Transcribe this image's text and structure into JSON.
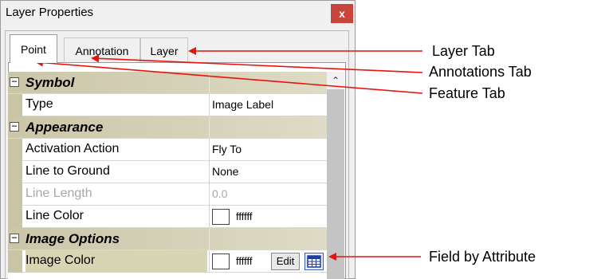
{
  "window": {
    "title": "Layer Properties",
    "close_glyph": "x"
  },
  "tabs": [
    {
      "label": "Point",
      "active": true
    },
    {
      "label": "Annotation",
      "active": false
    },
    {
      "label": "Layer",
      "active": false
    }
  ],
  "grid": {
    "expander_glyph": "−",
    "scroll_up_glyph": "⌃",
    "rows": [
      {
        "kind": "category",
        "label": "Symbol"
      },
      {
        "kind": "property",
        "name": "Type",
        "value": "Image Label"
      },
      {
        "kind": "category",
        "label": "Appearance"
      },
      {
        "kind": "property",
        "name": "Activation Action",
        "value": "Fly To"
      },
      {
        "kind": "property",
        "name": "Line to Ground",
        "value": "None"
      },
      {
        "kind": "property",
        "name": "Line Length",
        "value": "0.0",
        "disabled": true
      },
      {
        "kind": "property",
        "name": "Line Color",
        "value": "ffffff",
        "swatch": "#ffffff"
      },
      {
        "kind": "category",
        "label": "Image Options"
      },
      {
        "kind": "property",
        "name": "Image Color",
        "value": "ffffff",
        "swatch": "#ffffff",
        "edit_label": "Edit",
        "selected": true
      }
    ]
  },
  "annotations": {
    "layer_tab": "Layer Tab",
    "annotations_tab": "Annotations Tab",
    "feature_tab": "Feature Tab",
    "field_by_attribute": "Field by Attribute"
  },
  "colors": {
    "arrow": "#e8130c",
    "category_bg": "#cbc6a8",
    "close_button": "#c7453a"
  },
  "icons": {
    "close": "close-icon",
    "expander": "collapse-icon",
    "attribute_picker": "table-grid-icon",
    "scroll_up": "chevron-up-icon"
  }
}
